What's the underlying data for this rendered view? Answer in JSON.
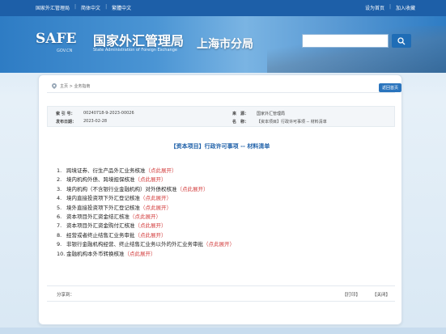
{
  "topbar": {
    "left_links": [
      "国家外汇管理局",
      "简体中文",
      "繁體中文"
    ],
    "right_links": [
      "设为首页",
      "加入收藏"
    ]
  },
  "header": {
    "logo_text": "SAFE",
    "logo_domain": "GOV.CN",
    "title": "国家外汇管理局",
    "subtitle": "State Administration of Foreign Exchange",
    "branch": "上海市分局",
    "search_placeholder": ""
  },
  "breadcrumb": {
    "text": "主页 > 业务指南"
  },
  "back_button": "返回首页",
  "meta": {
    "index_label": "索 引 号：",
    "index_value": "00240718-9-2023-00026",
    "source_label": "来　源：",
    "source_value": "国家外汇管理局",
    "date_label": "发布日期：",
    "date_value": "2023-02-28",
    "name_label": "名　称：",
    "name_value": "【资本项目】行政许可事项 -- 材料清单"
  },
  "doc_title": "【资本项目】行政许可事项 -- 材料清单",
  "items": [
    {
      "num": "1.",
      "text": "跨境证券、衍生产品外汇业务核准",
      "expand": "（点此展开）"
    },
    {
      "num": "2.",
      "text": "境内机构外债、跨境担保核准",
      "expand": "（点此展开）"
    },
    {
      "num": "3.",
      "text": "境内机构（不含银行业金融机构）对外债权核准",
      "expand": "（点此展开）"
    },
    {
      "num": "4.",
      "text": "境内直接投资项下外汇登记核准",
      "expand": "（点此展开）"
    },
    {
      "num": "5.",
      "text": "境外直接投资项下外汇登记核准",
      "expand": "（点此展开）"
    },
    {
      "num": "6.",
      "text": "资本项目外汇资金结汇核准",
      "expand": "（点此展开）"
    },
    {
      "num": "7.",
      "text": "资本项目外汇资金购付汇核准",
      "expand": "（点此展开）"
    },
    {
      "num": "8.",
      "text": "经营或者终止结售汇业务审批",
      "expand": "（点此展开）"
    },
    {
      "num": "9.",
      "text": "非银行金融机构经营、终止结售汇业务以外的外汇业务审批",
      "expand": "（点此展开）"
    },
    {
      "num": "10.",
      "text": "金融机构本外币转换核准",
      "expand": "（点此展开）"
    }
  ],
  "share": {
    "label": "分享到：",
    "print": "【打印】",
    "close": "【关闭】"
  },
  "colors": {
    "topbar": "#1d5fa8",
    "accent": "#2a74bd",
    "expand": "#d23b3b"
  }
}
